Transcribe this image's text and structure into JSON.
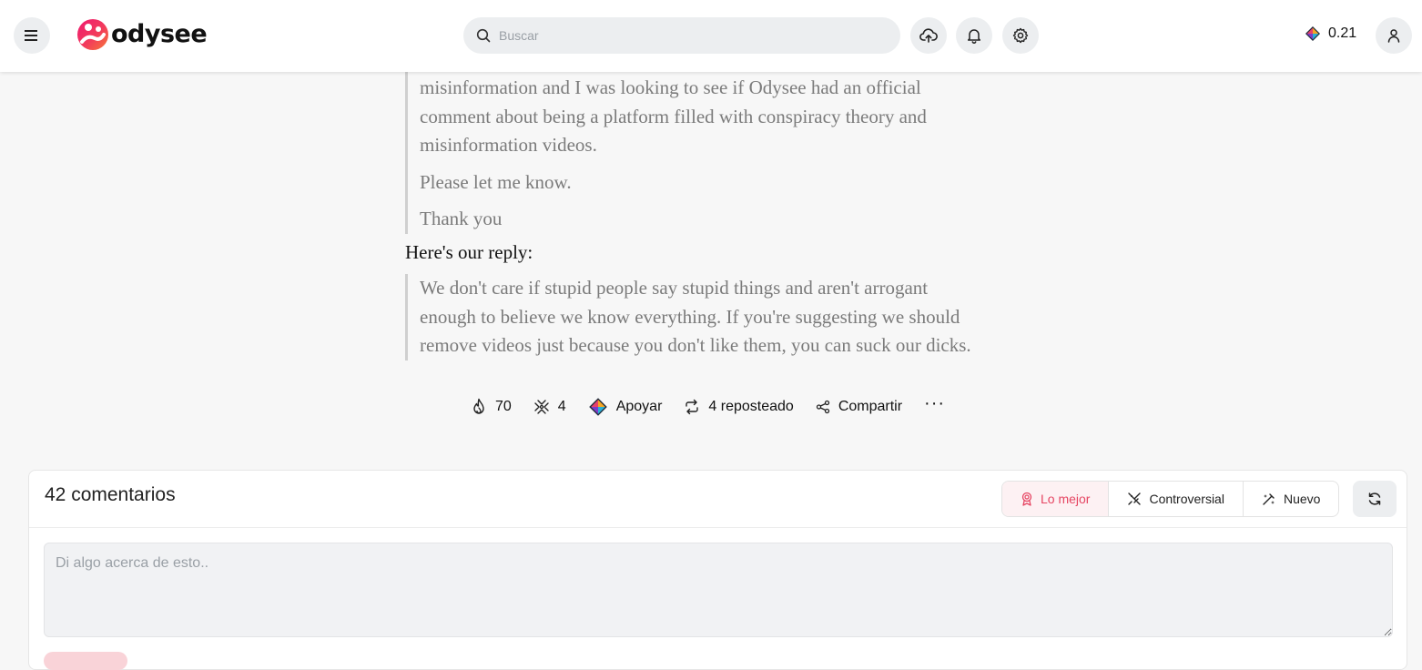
{
  "header": {
    "logo_text": "odysee",
    "search_placeholder": "Buscar",
    "balance": "0.21",
    "icons": [
      "menu-icon",
      "search-icon",
      "upload-icon",
      "bell-icon",
      "gear-icon",
      "credits-icon",
      "user-icon"
    ]
  },
  "article": {
    "quote1": [
      "misinformation and I was looking to see if Odysee had an official",
      "comment about being a platform filled with conspiracy theory and",
      "misinformation videos.",
      "Please let me know.",
      "Thank you"
    ],
    "reply_heading": "Here's our reply:",
    "quote2": [
      "We don't care if stupid people say stupid things and aren't arrogant",
      "enough to believe we know everything. If you're suggesting we should",
      "remove videos just because you don't like them, you can suck our dicks."
    ]
  },
  "actions": {
    "fire_count": "70",
    "slime_count": "4",
    "support_label": "Apoyar",
    "repost_label": "4 reposteado",
    "share_label": "Compartir",
    "more_label": "···"
  },
  "comments": {
    "count_label": "42 comentarios",
    "sort_best": "Lo mejor",
    "sort_controversial": "Controversial",
    "sort_new": "Nuevo",
    "input_placeholder": "Di algo acerca de esto.."
  },
  "colors": {
    "accent": "#e64663",
    "header_bg": "#ffffff",
    "page_bg": "#f7f7f7",
    "quote_text": "#7b7b7b"
  }
}
